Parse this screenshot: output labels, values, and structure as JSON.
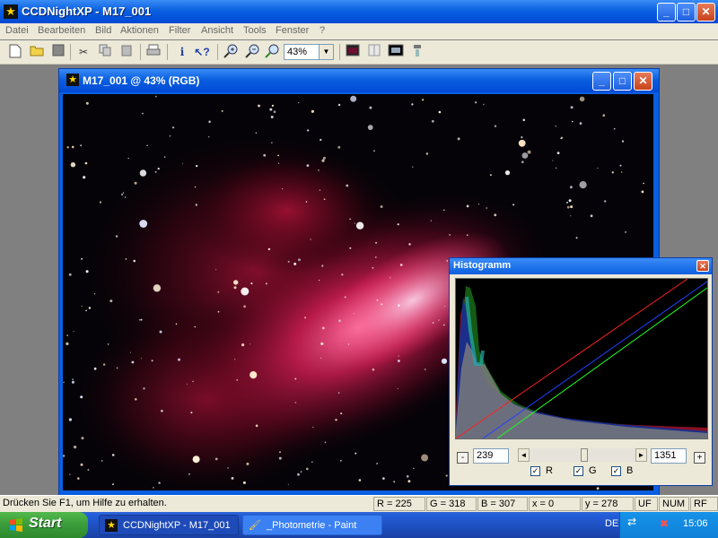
{
  "app": {
    "title": "CCDNightXP - M17_001",
    "icon": "star-app-icon"
  },
  "window_controls": {
    "minimize": "_",
    "maximize": "□",
    "close": "✕"
  },
  "menu": [
    "Datei",
    "Bearbeiten",
    "Bild",
    "Aktionen",
    "Filter",
    "Ansicht",
    "Tools",
    "Fenster",
    "?"
  ],
  "toolbar": {
    "zoom_value": "43%",
    "icons": [
      "new-file-icon",
      "open-folder-icon",
      "save-icon",
      "cut-icon",
      "copy-icon",
      "paste-icon",
      "print-icon",
      "info-icon",
      "context-help-icon",
      "zoom-in-icon",
      "zoom-out-icon",
      "zoom-fit-icon",
      "zoom-dropdown",
      "image-window-icon",
      "split-view-icon",
      "preview-icon",
      "align-icon"
    ]
  },
  "image_window": {
    "title": "M17_001 @ 43% (RGB)"
  },
  "histogram": {
    "title": "Histogramm",
    "low_value": "239",
    "high_value": "1351",
    "minus_label": "-",
    "plus_label": "+",
    "slider_left": "◄",
    "slider_right": "►",
    "channels": [
      {
        "label": "R",
        "checked": true,
        "color": "#ff2020"
      },
      {
        "label": "G",
        "checked": true,
        "color": "#20ff20"
      },
      {
        "label": "B",
        "checked": true,
        "color": "#2040ff"
      }
    ],
    "check_mark": "✓"
  },
  "statusbar": {
    "help": "Drücken Sie F1, um Hilfe zu erhalten.",
    "r": "R = 225",
    "g": "G = 318",
    "b": "B = 307",
    "x": "x = 0",
    "y": "y = 278",
    "uf": "UF",
    "num": "NUM",
    "rf": "RF"
  },
  "taskbar": {
    "start": "Start",
    "tasks": [
      {
        "label": "CCDNightXP - M17_001",
        "active": true
      },
      {
        "label": "_Photometrie - Paint",
        "active": false
      }
    ],
    "language": "DE",
    "clock": "15:06"
  },
  "colors": {
    "xp_blue": "#0a5fe0",
    "dialog_bg": "#ece9d8",
    "start_green": "#3a9b3a"
  }
}
